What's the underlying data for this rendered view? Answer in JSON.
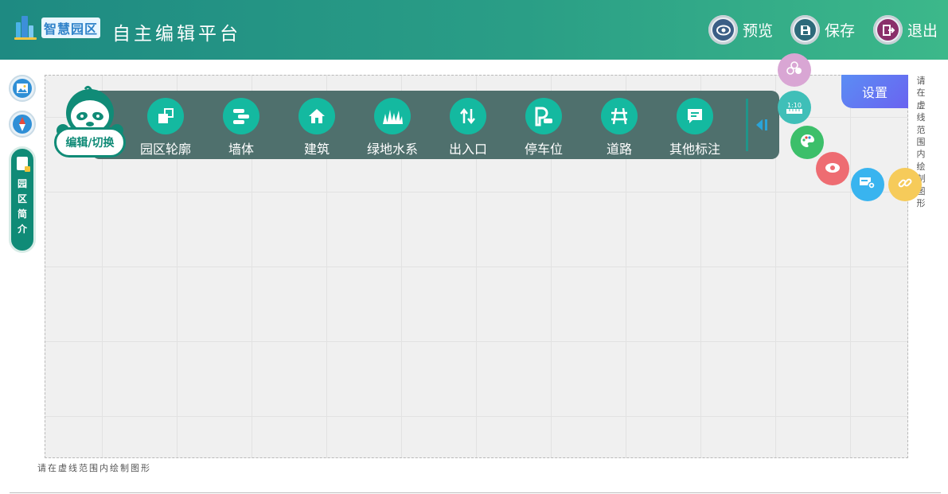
{
  "header": {
    "logo_text": "智慧园区",
    "title": "自主编辑平台",
    "actions": [
      {
        "label": "预览",
        "icon": "eye-icon",
        "color": "#3b5e86"
      },
      {
        "label": "保存",
        "icon": "save-icon",
        "color": "#2d6a7a"
      },
      {
        "label": "退出",
        "icon": "exit-icon",
        "color": "#8a2f6a"
      }
    ]
  },
  "left_tools": {
    "image_icon": "image-icon",
    "compass_icon": "compass-icon",
    "intro_label": "园区简介"
  },
  "mascot": {
    "label": "编辑/切换"
  },
  "toolbar": {
    "tools": [
      {
        "label": "园区轮廓",
        "icon": "outline-icon"
      },
      {
        "label": "墙体",
        "icon": "wall-icon"
      },
      {
        "label": "建筑",
        "icon": "home-icon"
      },
      {
        "label": "绿地水系",
        "icon": "grass-icon"
      },
      {
        "label": "出入口",
        "icon": "entrance-icon"
      },
      {
        "label": "停车位",
        "icon": "parking-icon"
      },
      {
        "label": "道路",
        "icon": "road-icon"
      },
      {
        "label": "其他标注",
        "icon": "note-icon"
      }
    ],
    "collapse_icon": "collapse-icon"
  },
  "floating": [
    {
      "icon": "layers-icon",
      "color": "#d9a6d4"
    },
    {
      "icon": "scale-icon",
      "text": "1:10",
      "color": "#3fbfb8"
    },
    {
      "icon": "palette-icon",
      "color": "#3cbf6a"
    },
    {
      "icon": "eye-icon",
      "color": "#ee6c72"
    },
    {
      "icon": "settings-card-icon",
      "color": "#39b4ef"
    },
    {
      "icon": "link-icon",
      "color": "#f6cb5a"
    }
  ],
  "settings": {
    "label": "设置"
  },
  "canvas": {
    "hint_bottom": "请在虚线范围内绘制图形",
    "hint_right": "请在虚线范围内绘制图形"
  },
  "colors": {
    "header_start": "#1e8a82",
    "header_end": "#3cb88a",
    "toolbar_bg": "#4f706d",
    "tool_icon": "#14b9a0",
    "brand_green": "#108b77"
  }
}
